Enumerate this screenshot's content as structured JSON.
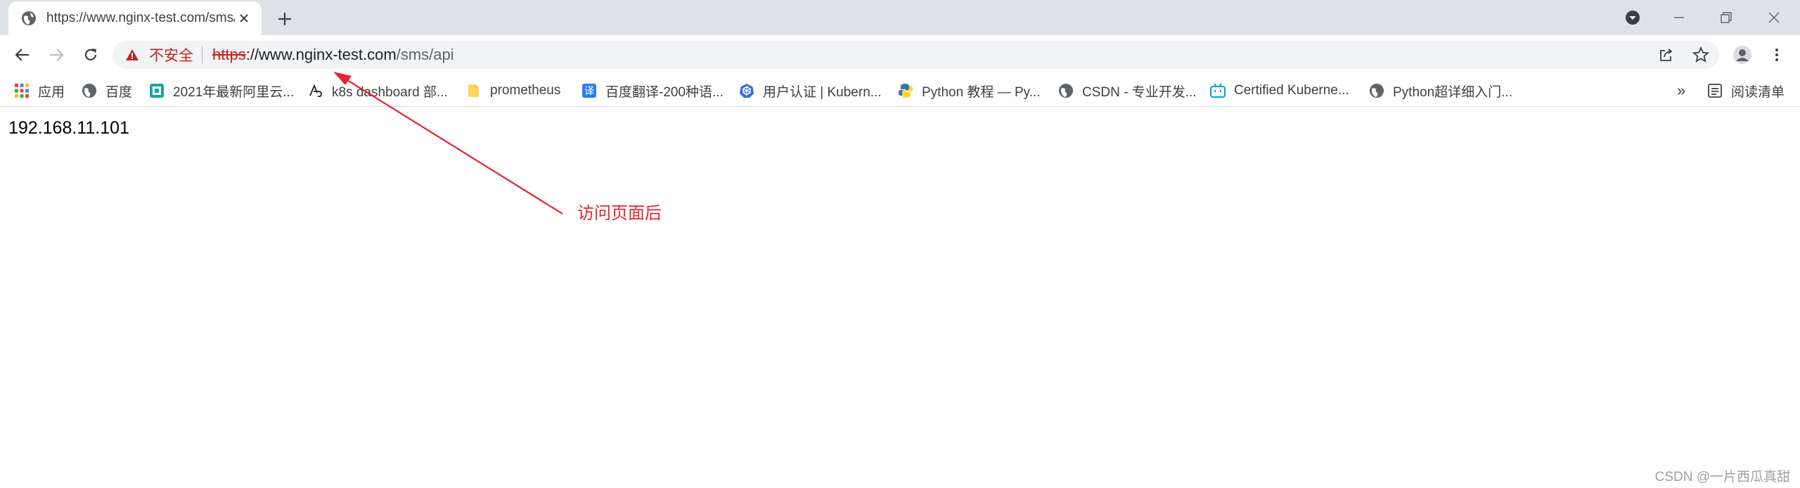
{
  "tab": {
    "title": "https://www.nginx-test.com/sms/api",
    "close_icon": "close-icon",
    "favicon": "globe-icon"
  },
  "toolbar": {
    "security_label": "不安全",
    "url_scheme": "https",
    "url_host": "://www.nginx-test.com",
    "url_path": "/sms/api"
  },
  "bookmarks": {
    "apps_label": "应用",
    "items": [
      {
        "label": "百度",
        "icon": "globe-icon"
      },
      {
        "label": "2021年最新阿里云...",
        "icon": "aliyun-icon"
      },
      {
        "label": "k8s dashboard 部...",
        "icon": "k8s-dashboard-icon"
      },
      {
        "label": "prometheus",
        "icon": "folder-icon"
      },
      {
        "label": "百度翻译-200种语...",
        "icon": "translate-icon"
      },
      {
        "label": "用户认证 | Kubern...",
        "icon": "kubernetes-icon"
      },
      {
        "label": "Python 教程 — Py...",
        "icon": "python-icon"
      },
      {
        "label": "CSDN - 专业开发...",
        "icon": "globe-icon"
      },
      {
        "label": "Certified Kuberne...",
        "icon": "bilibili-icon"
      },
      {
        "label": "Python超详细入门...",
        "icon": "globe-icon"
      }
    ],
    "more_label": "»",
    "reading_list_label": "阅读清单"
  },
  "page": {
    "body_text": "192.168.11.101"
  },
  "annotation": {
    "text": "访问页面后",
    "color": "#e8242b"
  },
  "watermark": "CSDN @一片西瓜真甜",
  "colors": {
    "tabstrip_bg": "#dee1e6",
    "omnibox_bg": "#f1f3f4",
    "insecure_red": "#c5221f"
  }
}
